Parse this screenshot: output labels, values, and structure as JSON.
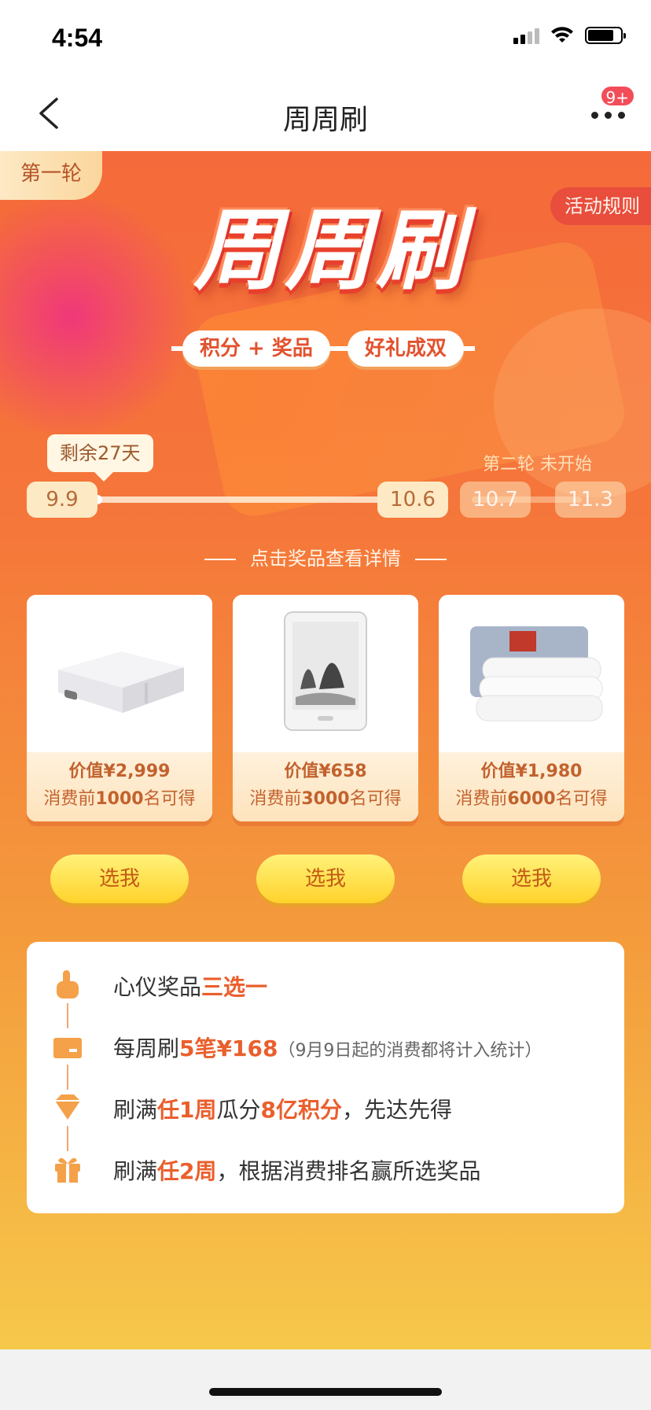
{
  "status_bar": {
    "time": "4:54"
  },
  "nav": {
    "title": "周周刷",
    "badge": "9+"
  },
  "banner": {
    "round_tag": "第一轮",
    "rules": "活动规则",
    "title": "周周刷",
    "pill_left": "积分 + 奖品",
    "pill_right": "好礼成双"
  },
  "progress": {
    "remaining": "剩余27天",
    "next_round": "第二轮 未开始",
    "dates": [
      "9.9",
      "10.6",
      "10.7",
      "11.3"
    ],
    "hint": "点击奖品查看详情"
  },
  "prizes": [
    {
      "value": "价值¥2,999",
      "cond_pre": "消费前",
      "cond_num": "1000",
      "cond_post": "名可得",
      "button": "选我",
      "icon": "projector-icon"
    },
    {
      "value": "价值¥658",
      "cond_pre": "消费前",
      "cond_num": "3000",
      "cond_post": "名可得",
      "button": "选我",
      "icon": "ereader-icon"
    },
    {
      "value": "价值¥1,980",
      "cond_pre": "消费前",
      "cond_num": "6000",
      "cond_post": "名可得",
      "button": "选我",
      "icon": "quilt-icon"
    }
  ],
  "info": {
    "row1": {
      "a": "心仪奖品",
      "hl": "三选一"
    },
    "row2": {
      "a": "每周刷",
      "hl": "5笔¥168",
      "small": "（9月9日起的消费都将计入统计）"
    },
    "row3": {
      "a": "刷满",
      "hl1": "任1周",
      "b": "瓜分",
      "hl2": "8亿积分",
      "c": "，先达先得"
    },
    "row4": {
      "a": "刷满",
      "hl": "任2周",
      "b": "，根据消费排名赢所选奖品"
    }
  },
  "colors": {
    "accent": "#ea5f2c",
    "button_yellow": "#ffd22b",
    "brand_red": "#e74c3c"
  }
}
